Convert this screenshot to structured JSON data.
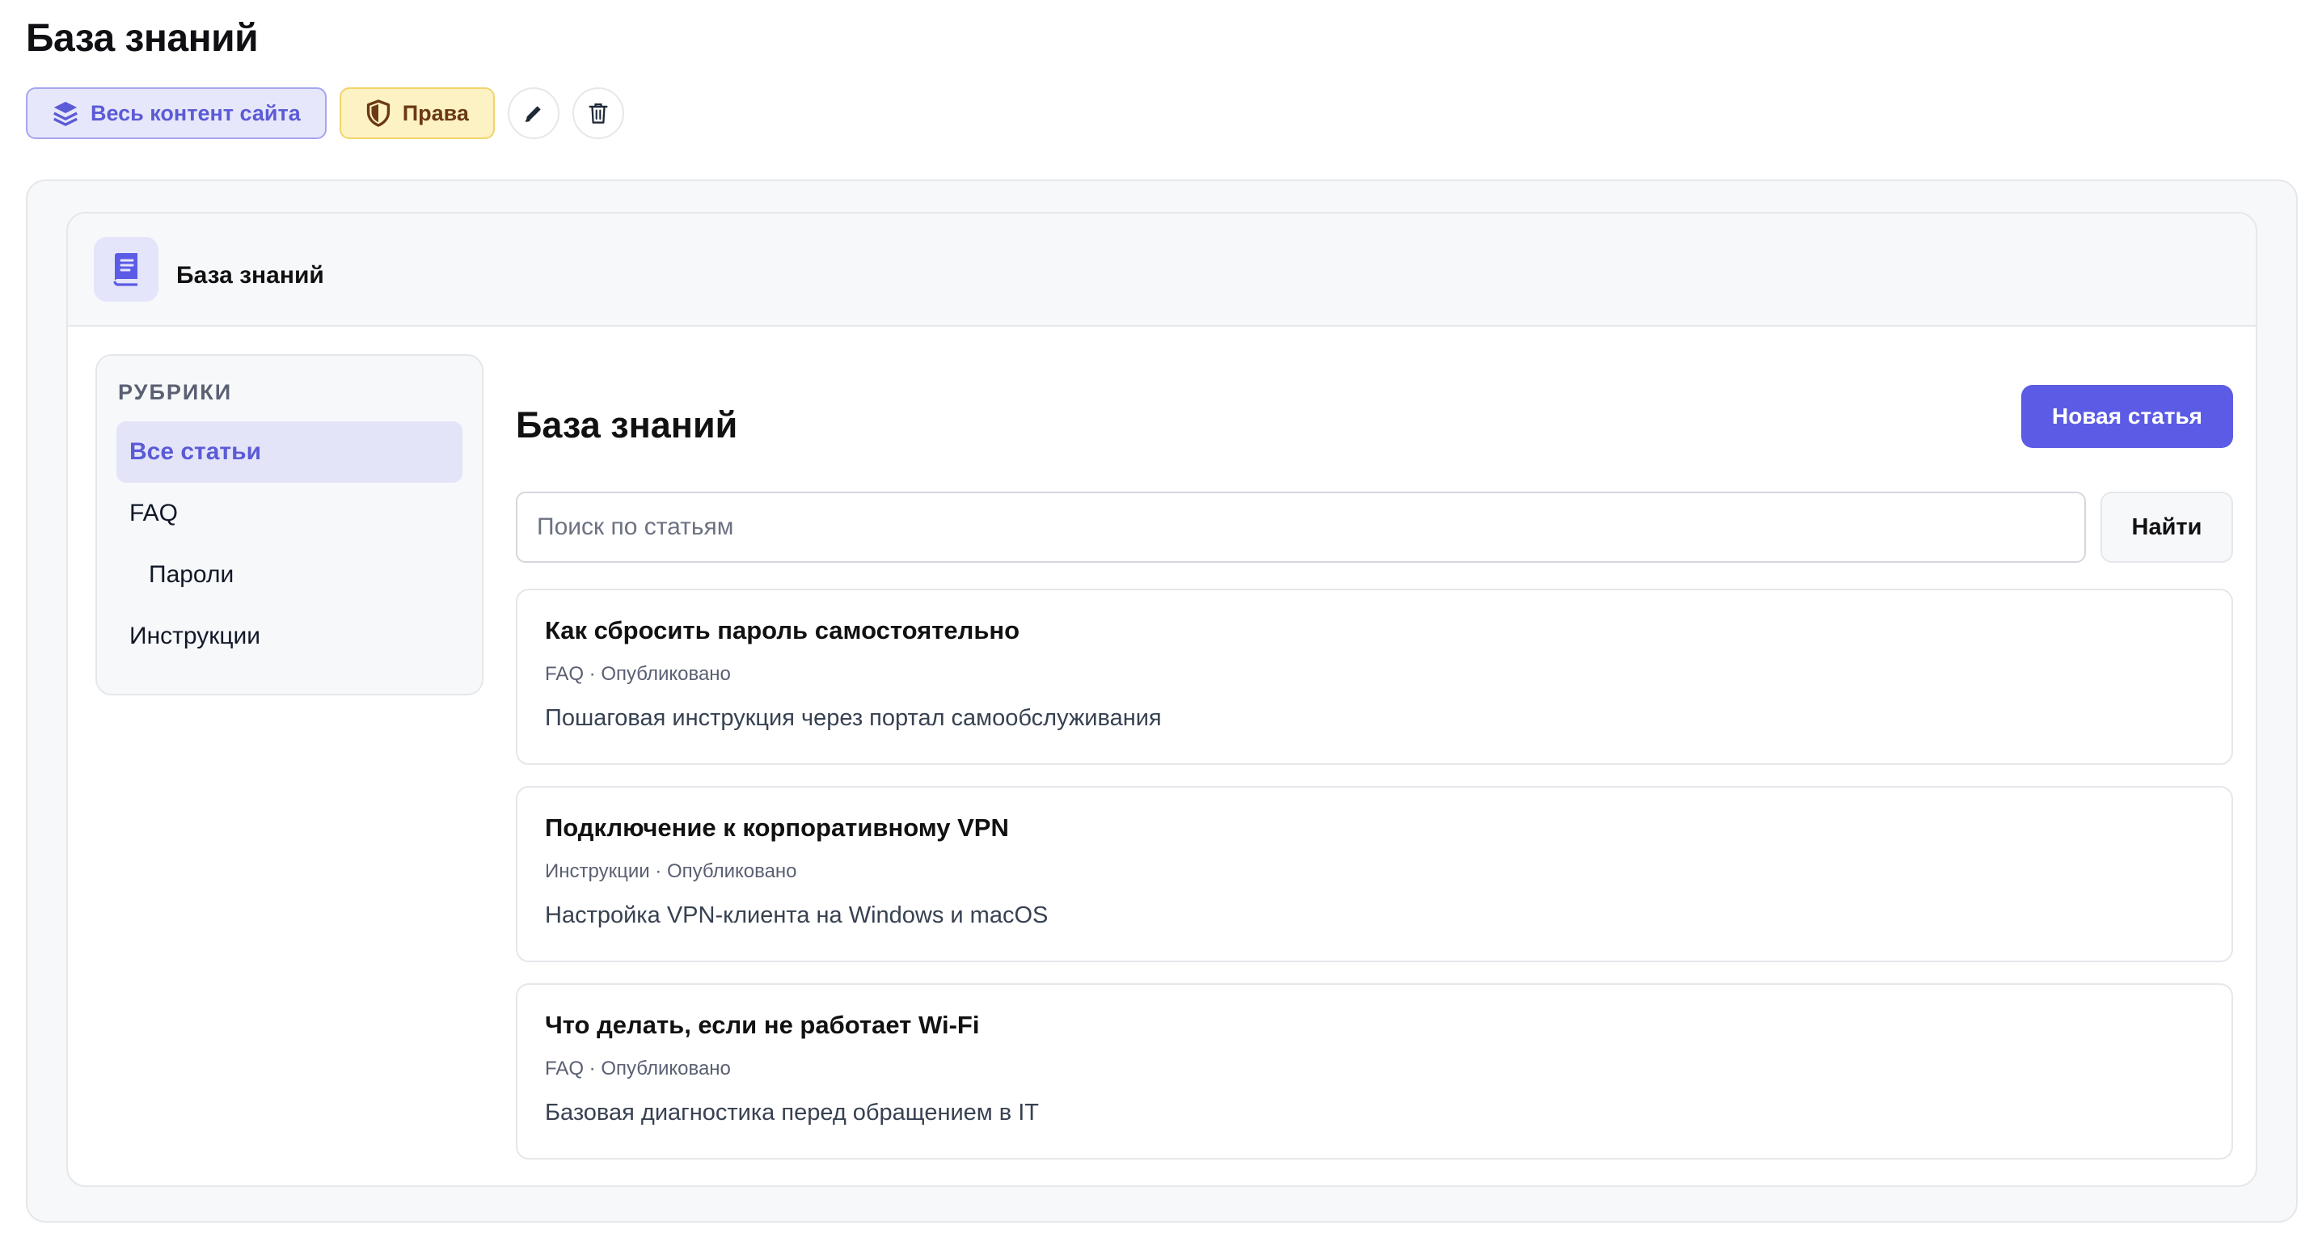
{
  "page": {
    "title": "База знаний"
  },
  "toolbar": {
    "content_label": "Весь контент сайта",
    "rights_label": "Права",
    "edit_icon": "pencil-icon",
    "delete_icon": "trash-icon"
  },
  "widget": {
    "icon": "book-icon",
    "title": "База знаний"
  },
  "sidebar": {
    "heading": "РУБРИКИ",
    "items": [
      {
        "label": "Все статьи",
        "active": true
      },
      {
        "label": "FAQ",
        "active": false
      },
      {
        "label": "Пароли",
        "active": false,
        "sub": true
      },
      {
        "label": "Инструкции",
        "active": false
      }
    ]
  },
  "main": {
    "title": "База знаний",
    "new_button": "Новая статья",
    "search": {
      "placeholder": "Поиск по статьям",
      "value": "",
      "button": "Найти"
    },
    "articles": [
      {
        "title": "Как сбросить пароль самостоятельно",
        "meta": "FAQ · Опубликовано",
        "description": "Пошаговая инструкция через портал самообслуживания"
      },
      {
        "title": "Подключение к корпоративному VPN",
        "meta": "Инструкции · Опубликовано",
        "description": "Настройка VPN-клиента на Windows и macOS"
      },
      {
        "title": "Что делать, если не работает Wi-Fi",
        "meta": "FAQ · Опубликовано",
        "description": "Базовая диагностика перед обращением в IT"
      }
    ]
  },
  "colors": {
    "accent": "#5b5be6",
    "accent_soft": "#e4e4f8",
    "rights_bg": "#fdf2c4",
    "rights_text": "#6b3a14"
  }
}
